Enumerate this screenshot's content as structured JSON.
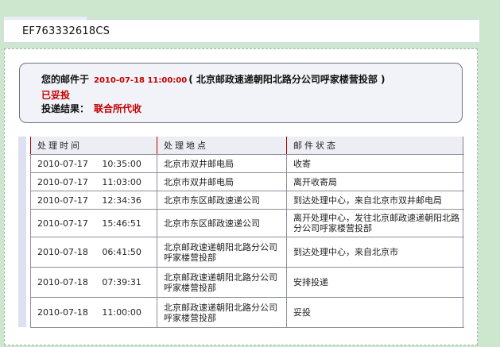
{
  "tracking_number": "EF763332618CS",
  "summary": {
    "prefix": "您的邮件于",
    "date": "2010-07-18 11:00:00",
    "location": "( 北京邮政速递朝阳北路分公司呼家楼营投部 )",
    "status": "已妥投",
    "result_label": "投递结果：",
    "result_value": "联合所代收"
  },
  "table": {
    "headers": [
      "处理时间",
      "处理地点",
      "邮件状态"
    ],
    "rows": [
      {
        "time": "2010-07-17     10:35:00",
        "place": "北京市双井邮电局",
        "status": "收寄"
      },
      {
        "time": "2010-07-17     11:03:00",
        "place": "北京市双井邮电局",
        "status": "离开收寄局"
      },
      {
        "time": "2010-07-17     12:34:36",
        "place": "北京市东区邮政速递公司",
        "status": "到达处理中心，来自北京市双井邮电局"
      },
      {
        "time": "2010-07-17     15:46:51",
        "place": "北京市东区邮政速递公司",
        "status": "离开处理中心，发往北京邮政速递朝阳北路分公司呼家楼营投部"
      },
      {
        "time": "2010-07-18     06:41:50",
        "place": "北京邮政速递朝阳北路分公司呼家楼营投部",
        "status": "到达处理中心，来自北京市"
      },
      {
        "time": "2010-07-18     07:39:31",
        "place": "北京邮政速递朝阳北路分公司呼家楼营投部",
        "status": "安排投递"
      },
      {
        "time": "2010-07-18     11:00:00",
        "place": "北京邮政速递朝阳北路分公司呼家楼营投部",
        "status": "妥投"
      }
    ]
  },
  "colors": {
    "background": "#cde7cf",
    "accent_red": "#c30000",
    "summary_bg": "#f2f3f8"
  }
}
